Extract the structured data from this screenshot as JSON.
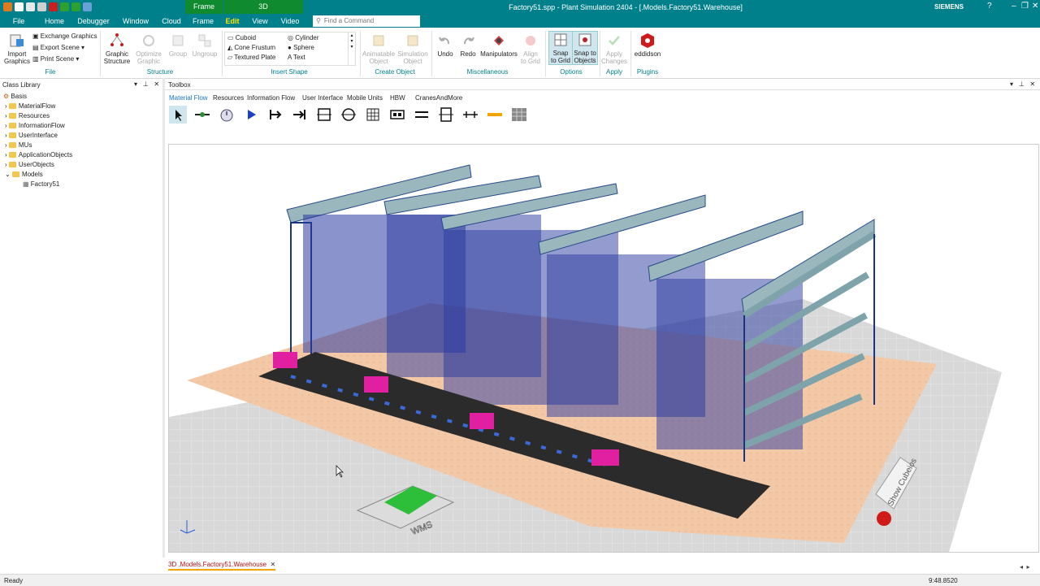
{
  "window": {
    "title": "Factory51.spp - Plant Simulation 2404 - [.Models.Factory51.Warehouse]",
    "brand": "SIEMENS",
    "context_frame": "Frame",
    "context_3d": "3D"
  },
  "menu": [
    "File",
    "Home",
    "Debugger",
    "Window",
    "Cloud",
    "Frame",
    "Edit",
    "View",
    "Video"
  ],
  "menu_active": "Edit",
  "find": {
    "placeholder": "Find a Command"
  },
  "ribbon": {
    "file": {
      "import": "Import\nGraphics",
      "exchange": "Exchange Graphics",
      "export": "Export Scene",
      "print": "Print Scene",
      "group": "File"
    },
    "structure": {
      "graphic_structure": "Graphic\nStructure",
      "optimize": "Optimize\nGraphic",
      "group_btn": "Group",
      "ungroup": "Ungroup",
      "group": "Structure"
    },
    "shapes": {
      "cuboid": "Cuboid",
      "cone": "Cone Frustum",
      "plate": "Textured Plate",
      "cylinder": "Cylinder",
      "sphere": "Sphere",
      "text": "Text",
      "group": "Insert Shape"
    },
    "create": {
      "animatable": "Animatable\nObject",
      "simulation": "Simulation\nObject",
      "group": "Create Object"
    },
    "misc": {
      "undo": "Undo",
      "redo": "Redo",
      "manip": "Manipulators",
      "align": "Align\nto Grid",
      "group": "Miscellaneous"
    },
    "options": {
      "snap_grid": "Snap\nto Grid",
      "snap_obj": "Snap to\nObjects",
      "group": "Options"
    },
    "apply": {
      "apply": "Apply\nChanges",
      "group": "Apply"
    },
    "plugins": {
      "eddi": "eddidson",
      "group": "Plugins"
    }
  },
  "class_library": {
    "title": "Class Library",
    "items": [
      "Basis",
      "MaterialFlow",
      "Resources",
      "InformationFlow",
      "UserInterface",
      "MUs",
      "ApplicationObjects",
      "UserObjects",
      "Models",
      "Factory51"
    ]
  },
  "toolbox": {
    "title": "Toolbox",
    "tabs": [
      "Material Flow",
      "Resources",
      "Information Flow",
      "User Interface",
      "Mobile Units",
      "HBW",
      "CranesAndMore"
    ],
    "active": "Material Flow"
  },
  "scene": {
    "wms_label": "WMS",
    "show_cubeios": "Show Cubeios"
  },
  "doc_tab": "3D .Models.Factory51.Warehouse",
  "status": {
    "left": "Ready",
    "right": "9:48.8520"
  }
}
